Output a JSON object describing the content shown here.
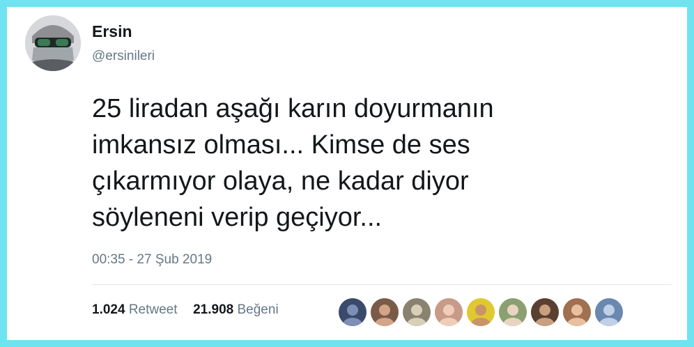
{
  "tweet": {
    "user": {
      "name": "Ersin",
      "handle": "@ersinileri",
      "avatar_icon": "avatar-masked-sunglasses"
    },
    "text_lines": [
      "25 liradan aşağı karın doyurmanın",
      "imkansız olması... Kimse de ses",
      "çıkarmıyor olaya, ne kadar diyor",
      "söyleneni verip geçiyor..."
    ],
    "timestamp": "00:35 - 27 Şub 2019",
    "stats": {
      "retweets_count": "1.024",
      "retweets_label": "Retweet",
      "likes_count": "21.908",
      "likes_label": "Beğeni"
    },
    "likers": [
      {
        "icon": "liker-avatar-1",
        "bg": "#3a4a6a",
        "fg": "#7d8fb5"
      },
      {
        "icon": "liker-avatar-2",
        "bg": "#7a5a48",
        "fg": "#d4a488"
      },
      {
        "icon": "liker-avatar-3",
        "bg": "#8a8270",
        "fg": "#d9cfb8"
      },
      {
        "icon": "liker-avatar-4",
        "bg": "#c89a88",
        "fg": "#f0cdb8"
      },
      {
        "icon": "liker-avatar-5",
        "bg": "#e0c830",
        "fg": "#c89468"
      },
      {
        "icon": "liker-avatar-6",
        "bg": "#8aa070",
        "fg": "#e8d4c0"
      },
      {
        "icon": "liker-avatar-7",
        "bg": "#5a4030",
        "fg": "#c8a080"
      },
      {
        "icon": "liker-avatar-8",
        "bg": "#a07050",
        "fg": "#e8c0a0"
      },
      {
        "icon": "liker-avatar-9",
        "bg": "#6a88b0",
        "fg": "#c0d0e8"
      }
    ],
    "frame_color": "#6fe3ef",
    "text_color": "#14171a",
    "muted_color": "#657786"
  }
}
